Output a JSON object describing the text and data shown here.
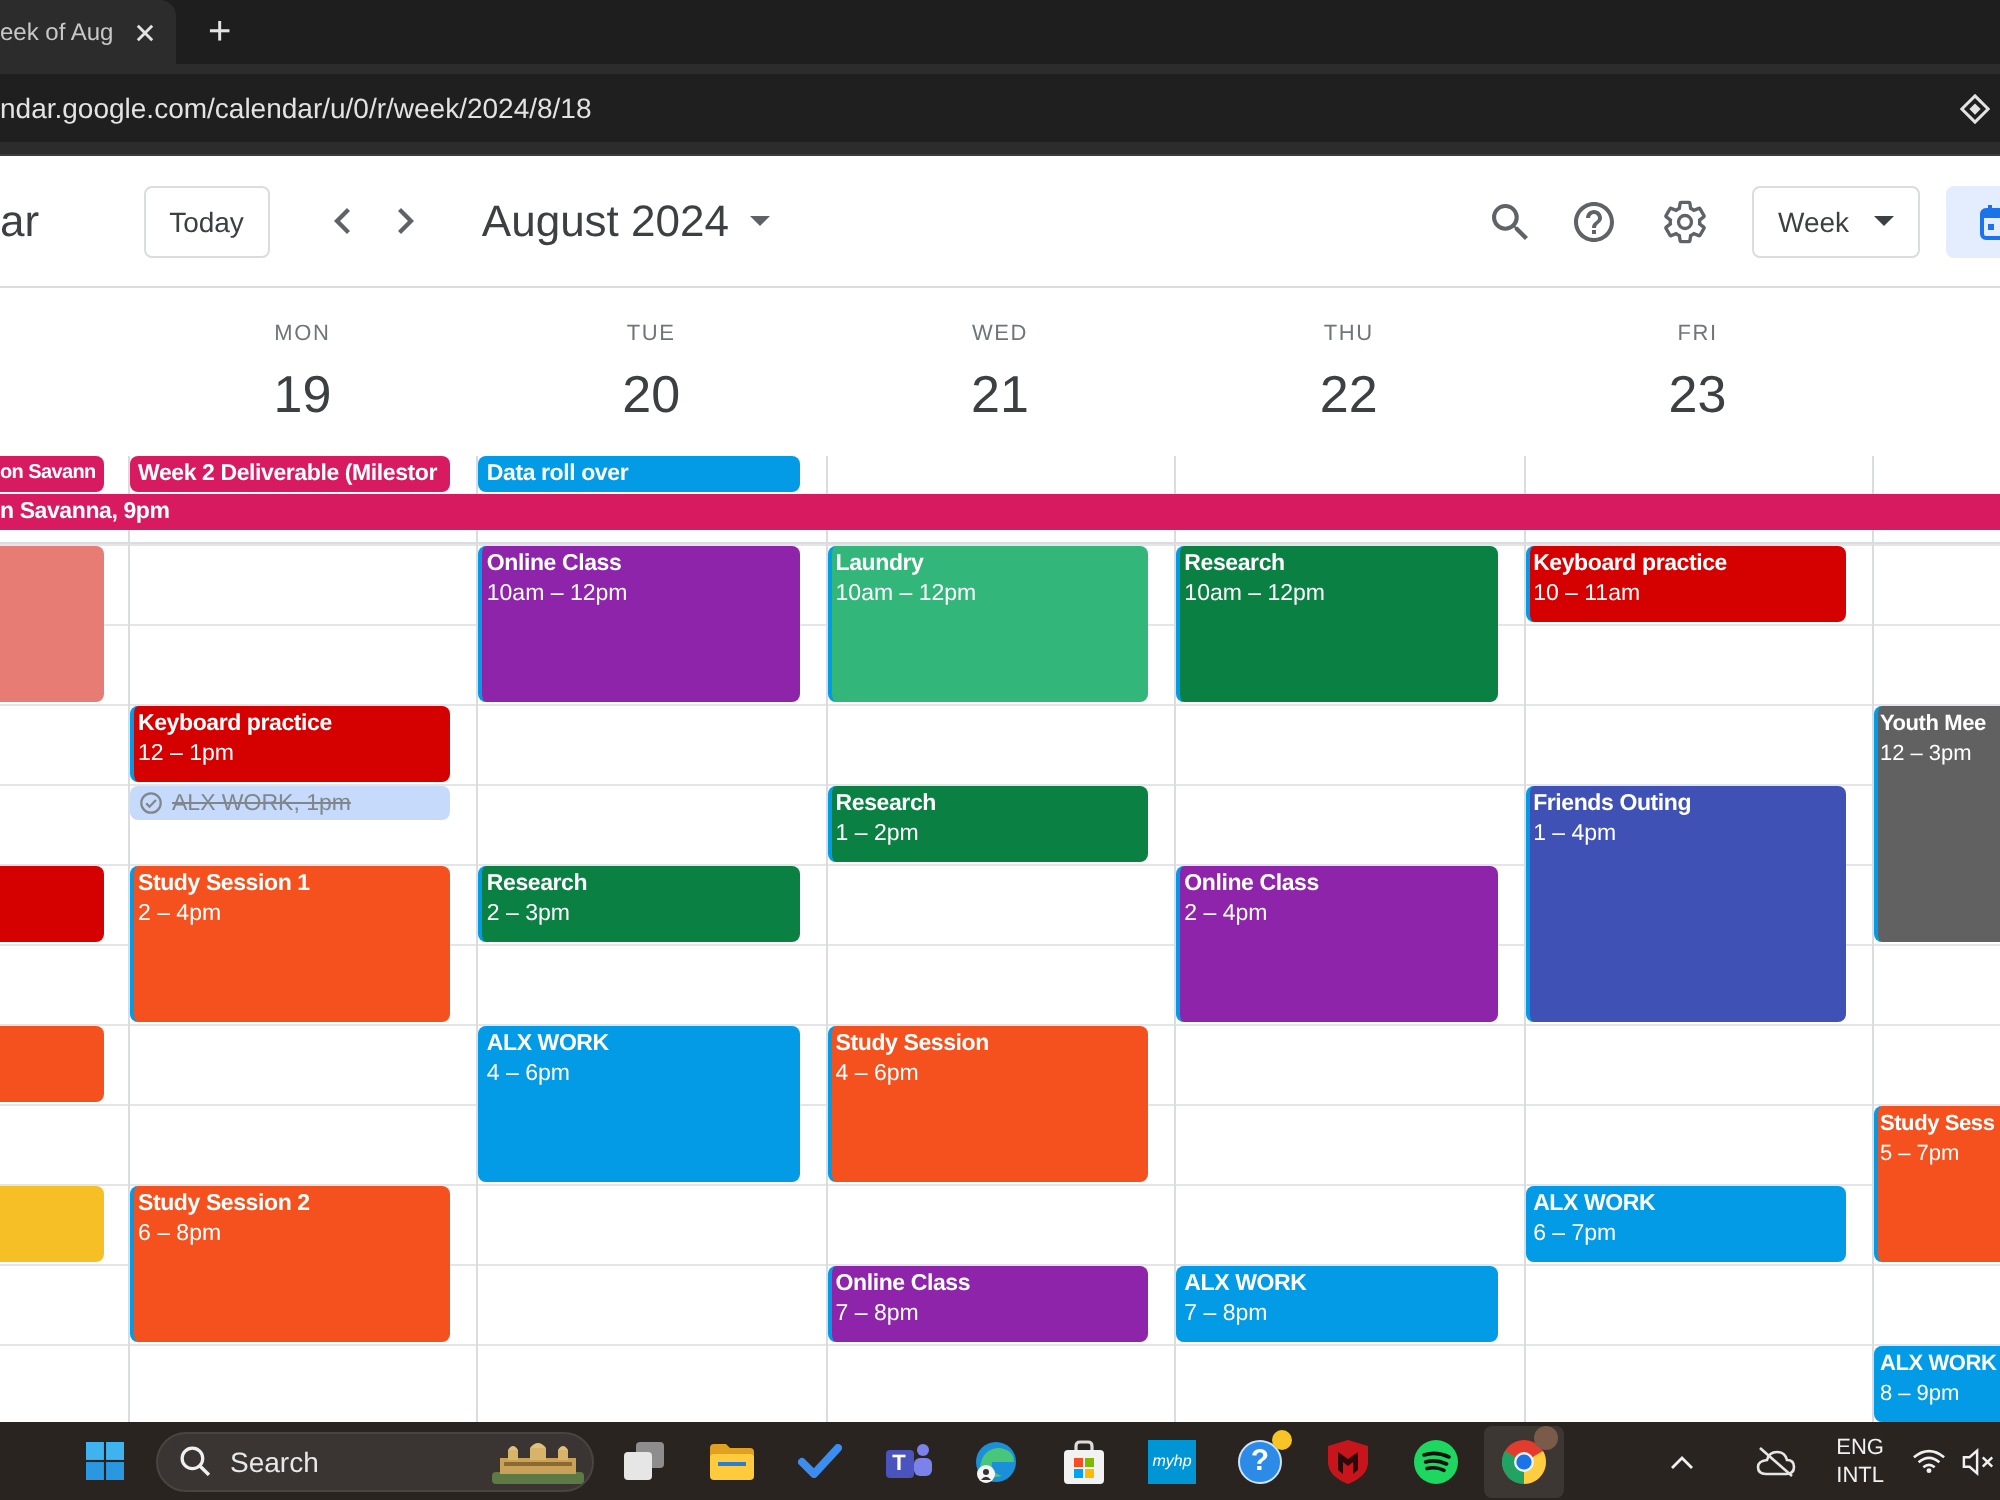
{
  "browser": {
    "tab_title": "eek of Aug",
    "new_tab": "+",
    "url": "ndar.google.com/calendar/u/0/r/week/2024/8/18"
  },
  "app_bar": {
    "app_name": "ar",
    "today": "Today",
    "period": "August 2024",
    "view": "Week"
  },
  "columns": [
    {
      "all_day": [
        {
          "title": "on Savann",
          "color": "#d81b60"
        }
      ],
      "hours": [
        {
          "kind": "event",
          "color": "#e67c73"
        },
        {
          "kind": "continued"
        },
        {
          "kind": "free"
        },
        {
          "kind": "free"
        },
        {
          "kind": "event",
          "color": "#d50000"
        },
        {
          "kind": "free"
        },
        {
          "kind": "event",
          "color": "#f4511e"
        },
        {
          "kind": "free"
        },
        {
          "kind": "event",
          "color": "#f6bf26"
        }
      ]
    },
    {
      "day": "MON",
      "date": "19",
      "all_day": [
        {
          "title": "Week 2 Deliverable (Milestor",
          "color": "#d81b60"
        }
      ],
      "hours": [
        {
          "kind": "free"
        },
        {
          "kind": "free"
        },
        {
          "kind": "event",
          "title": "Keyboard practice",
          "time": "12 – 1pm",
          "color": "#d50000"
        },
        {
          "kind": "task",
          "title": "ALX WORK, 1pm",
          "done": true
        },
        {
          "kind": "event",
          "title": "Study Session 1",
          "time": "2 – 4pm",
          "color": "#f4511e"
        },
        {
          "kind": "continued"
        },
        {
          "kind": "free"
        },
        {
          "kind": "free"
        },
        {
          "kind": "event",
          "title": "Study Session 2",
          "time": "6 – 8pm",
          "color": "#f4511e"
        },
        {
          "kind": "continued"
        }
      ]
    },
    {
      "day": "TUE",
      "date": "20",
      "all_day": [
        {
          "title": "Data roll over",
          "color": "#039be5"
        }
      ],
      "hours": [
        {
          "kind": "event",
          "title": "Online Class",
          "time": "10am – 12pm",
          "color": "#8e24aa"
        },
        {
          "kind": "continued"
        },
        {
          "kind": "free"
        },
        {
          "kind": "free"
        },
        {
          "kind": "event",
          "title": "Research",
          "time": "2 – 3pm",
          "color": "#0b8043"
        },
        {
          "kind": "free"
        },
        {
          "kind": "event",
          "title": "ALX WORK",
          "time": "4 – 6pm",
          "color": "#039be5"
        },
        {
          "kind": "continued"
        }
      ]
    },
    {
      "day": "WED",
      "date": "21",
      "hours": [
        {
          "kind": "event",
          "title": "Laundry",
          "time": "10am – 12pm",
          "color": "#33b679"
        },
        {
          "kind": "continued"
        },
        {
          "kind": "free"
        },
        {
          "kind": "event",
          "title": "Research",
          "time": "1 – 2pm",
          "color": "#0b8043"
        },
        {
          "kind": "free"
        },
        {
          "kind": "free"
        },
        {
          "kind": "event",
          "title": "Study Session",
          "time": "4 – 6pm",
          "color": "#f4511e"
        },
        {
          "kind": "continued"
        },
        {
          "kind": "free"
        },
        {
          "kind": "event",
          "title": "Online Class",
          "time": "7 – 8pm",
          "color": "#8e24aa"
        }
      ]
    },
    {
      "day": "THU",
      "date": "22",
      "hours": [
        {
          "kind": "event",
          "title": "Research",
          "time": "10am – 12pm",
          "color": "#0b8043"
        },
        {
          "kind": "continued"
        },
        {
          "kind": "free"
        },
        {
          "kind": "free"
        },
        {
          "kind": "event",
          "title": "Online Class",
          "time": "2 – 4pm",
          "color": "#8e24aa"
        },
        {
          "kind": "continued"
        },
        {
          "kind": "free"
        },
        {
          "kind": "free"
        },
        {
          "kind": "free"
        },
        {
          "kind": "event",
          "title": "ALX WORK",
          "time": "7 – 8pm",
          "color": "#039be5"
        }
      ]
    },
    {
      "day": "FRI",
      "date": "23",
      "hours": [
        {
          "kind": "event",
          "title": "Keyboard practice",
          "time": "10 – 11am",
          "color": "#d50000"
        },
        {
          "kind": "free"
        },
        {
          "kind": "free"
        },
        {
          "kind": "event",
          "title": "Friends Outing",
          "time": "1 – 4pm",
          "color": "#3f51b5"
        },
        {
          "kind": "continued"
        },
        {
          "kind": "continued"
        },
        {
          "kind": "free"
        },
        {
          "kind": "free"
        },
        {
          "kind": "event",
          "title": "ALX WORK",
          "time": "6 – 7pm",
          "color": "#039be5"
        }
      ]
    },
    {
      "hours": [
        {
          "kind": "free"
        },
        {
          "kind": "free"
        },
        {
          "kind": "event",
          "title": "Youth Mee",
          "time": "12 – 3pm",
          "color": "#616161"
        },
        {
          "kind": "continued"
        },
        {
          "kind": "continued"
        },
        {
          "kind": "free"
        },
        {
          "kind": "free"
        },
        {
          "kind": "event",
          "title": "Study Sess",
          "time": "5 – 7pm",
          "color": "#f4511e"
        },
        {
          "kind": "continued"
        },
        {
          "kind": "free"
        },
        {
          "kind": "event",
          "title": "ALX WORK",
          "time": "8 – 9pm",
          "color": "#039be5"
        }
      ]
    }
  ],
  "spanning_event": {
    "title": "n Savanna, 9pm",
    "color": "#d81b60"
  },
  "taskbar": {
    "search": {
      "placeholder": "Search"
    },
    "apps": [
      {
        "kind": "taskview",
        "active": false,
        "notification": false
      },
      {
        "kind": "files",
        "active": false,
        "notification": false
      },
      {
        "kind": "todo",
        "active": false,
        "notification": false
      },
      {
        "kind": "teams",
        "glyph": "T",
        "active": false,
        "notification": false
      },
      {
        "kind": "edge",
        "active": false,
        "notification": false
      },
      {
        "kind": "store",
        "active": false,
        "notification": false
      },
      {
        "kind": "hp",
        "glyph": "myhp",
        "active": false,
        "notification": false
      },
      {
        "kind": "help",
        "glyph": "?",
        "active": false,
        "notification": true
      },
      {
        "kind": "antivirus",
        "active": false,
        "notification": false
      },
      {
        "kind": "music",
        "active": false,
        "notification": false
      },
      {
        "kind": "chrome",
        "active": true,
        "notification": false
      }
    ],
    "language": "ENG",
    "layout": "INTL"
  }
}
